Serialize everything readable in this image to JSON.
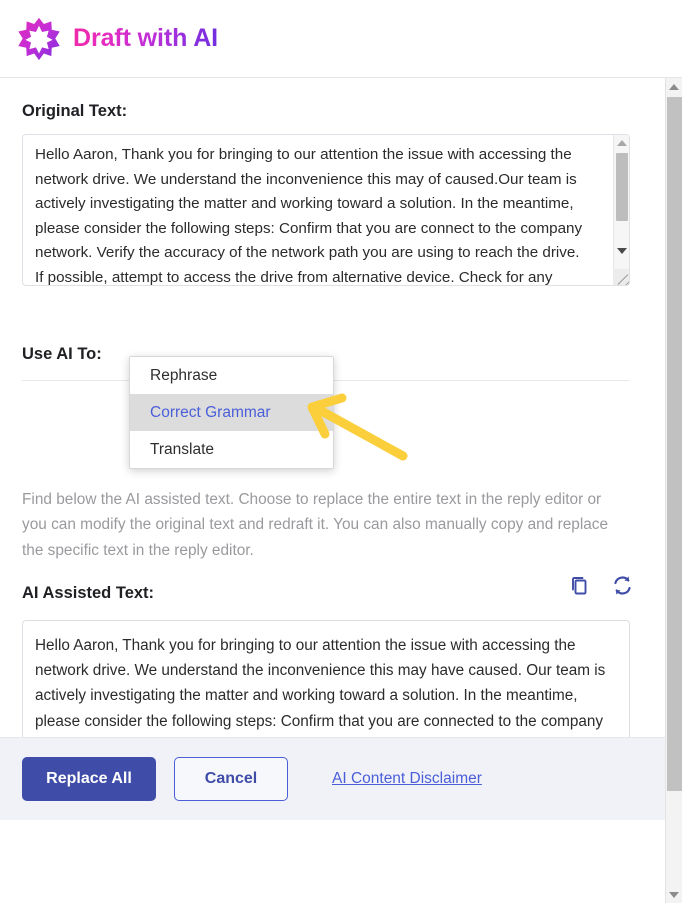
{
  "header": {
    "title": "Draft with AI",
    "icon": "ai-star-burst-icon",
    "gradient_from": "#f02ba6",
    "gradient_to": "#6f2ee0"
  },
  "original_section": {
    "label": "Original Text:",
    "text": "Hello Aaron, Thank you for bringing to our attention the issue with accessing the network drive. We understand the inconvenience this may of caused.Our team is actively investigating the matter and working toward a solution. In the meantime, please consider the following steps: Confirm that you are connect to the company network. Verify the accuracy of the network path you are using to reach the drive. If possible, attempt to access the drive from alternative device. Check for any firewall or VPN restrictions that could impede your access. If"
  },
  "use_ai_section": {
    "label": "Use AI To:"
  },
  "dropdown": {
    "items": [
      {
        "label": "Rephrase",
        "selected": false
      },
      {
        "label": "Correct Grammar",
        "selected": true
      },
      {
        "label": "Translate",
        "selected": false
      }
    ],
    "selected_color": "#4a5ed8",
    "selected_background": "#dcdcdc"
  },
  "annotation": {
    "type": "pointer-arrow",
    "color": "#fbcf3c",
    "points_to": "Correct Grammar"
  },
  "description": "Find below the AI assisted text. Choose to replace the entire text in the reply editor or you can modify the original text and redraft it. You can also manually copy and replace the specific text in the reply editor.",
  "ai_section": {
    "label": "AI Assisted Text:",
    "copy_icon": "copy-icon",
    "refresh_icon": "refresh-icon",
    "icon_color": "#3f4ca8",
    "text": "Hello Aaron, Thank you for bringing to our attention the issue with accessing the network drive. We understand the inconvenience this may have caused. Our team is actively investigating the matter and working toward a solution. In the meantime, please consider the following steps: Confirm that you are connected to the company network. Verify the accuracy of the network path you are using to reach the drive. If possible, attempt to access the drive from an alternative device. Check for any firewall or VPN restrictions that could impede your access. If these steps do not resolve the issue, please inform us so we can further escalate the matter. We will provide you with updates on our progress and notify you"
  },
  "footer": {
    "replace_all_label": "Replace All",
    "cancel_label": "Cancel",
    "disclaimer_label": "AI Content Disclaimer",
    "primary_color": "#3f4ca8",
    "background": "#f1f2f7"
  }
}
